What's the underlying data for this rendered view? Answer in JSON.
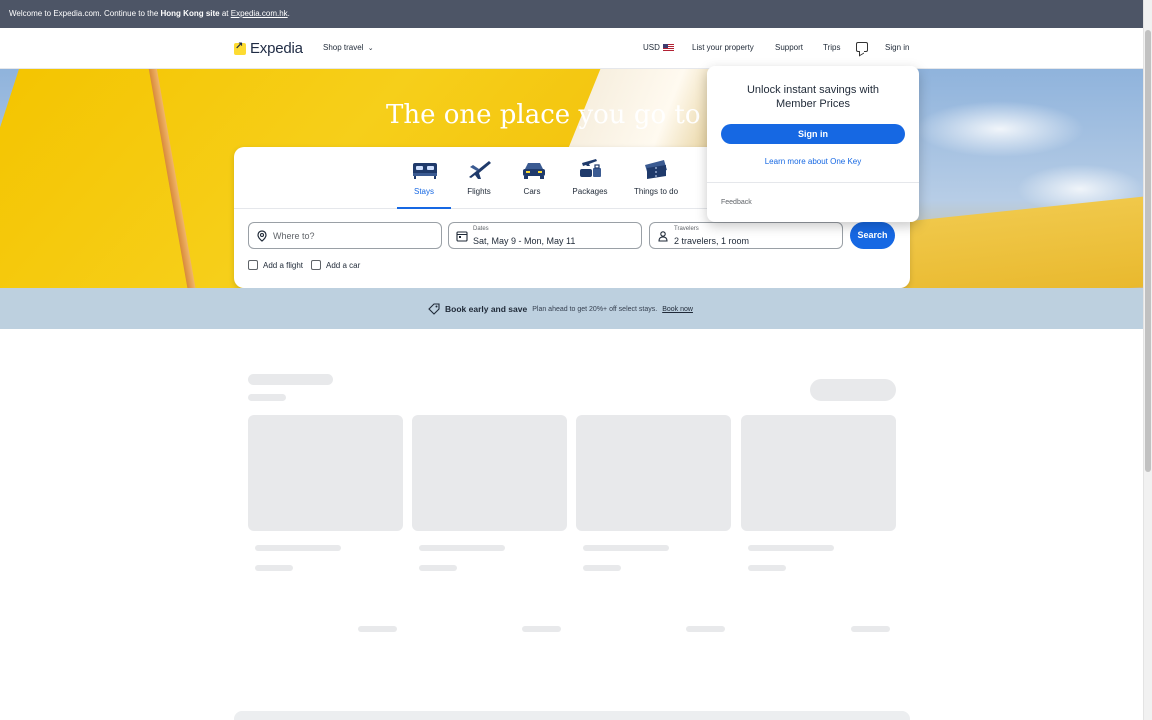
{
  "banner": {
    "prefix": "Welcome to Expedia.com. Continue to the ",
    "bold": "Hong Kong site",
    "middle": " at ",
    "link": "Expedia.com.hk",
    "suffix": "."
  },
  "header": {
    "logo_text": "Expedia",
    "shop_travel": "Shop travel",
    "currency": "USD",
    "list_property": "List your property",
    "support": "Support",
    "trips": "Trips",
    "sign_in": "Sign in"
  },
  "hero": {
    "title": "The one place you go to go pl"
  },
  "tabs": [
    {
      "label": "Stays",
      "icon": "bed-icon",
      "active": true
    },
    {
      "label": "Flights",
      "icon": "airplane-icon",
      "active": false
    },
    {
      "label": "Cars",
      "icon": "car-icon",
      "active": false
    },
    {
      "label": "Packages",
      "icon": "packages-icon",
      "active": false
    },
    {
      "label": "Things to do",
      "icon": "ticket-icon",
      "active": false
    }
  ],
  "search": {
    "destination_placeholder": "Where to?",
    "dates_label": "Dates",
    "dates_value": "Sat, May 9 - Mon, May 11",
    "travelers_label": "Travelers",
    "travelers_value": "2 travelers, 1 room",
    "search_button": "Search",
    "add_flight": "Add a flight",
    "add_car": "Add a car"
  },
  "dropdown": {
    "title_line1": "Unlock instant savings with",
    "title_line2": "Member Prices",
    "sign_in_button": "Sign in",
    "learn_more": "Learn more about One Key",
    "feedback": "Feedback"
  },
  "promo": {
    "title": "Book early and save",
    "subtitle": "Plan ahead to get 20%+ off select stays.",
    "link": "Book now"
  },
  "colors": {
    "brand_blue": "#1668e3",
    "banner_bg": "#4d5566",
    "promo_bg": "#bdd0df",
    "skeleton": "#e8e9eb"
  }
}
